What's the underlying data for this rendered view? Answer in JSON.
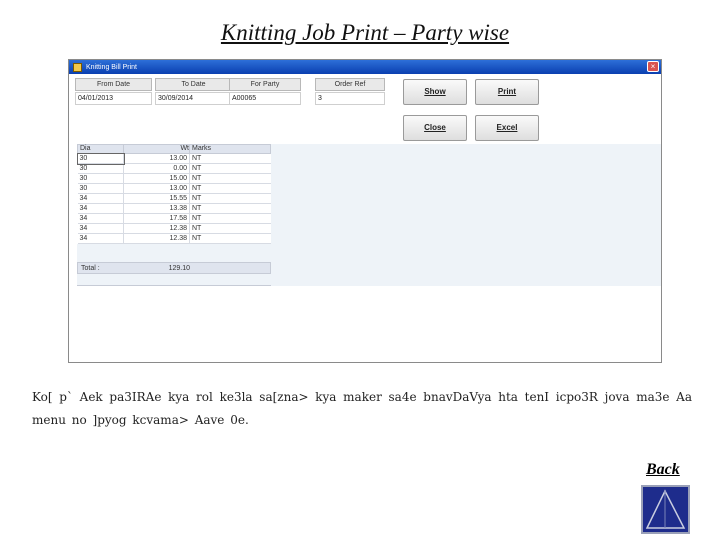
{
  "slide": {
    "title": "Knitting Job Print – Party wise",
    "description": "Ko[ p` Aek pa3IRAe kya rol ke3la sa[zna> kya maker sa4e bnavDaVya hta tenI icpo3R jova ma3e Aa menu  no ]pyog kcvama> Aave 0e.",
    "back_label": "Back"
  },
  "window": {
    "title": "Knitting Bill Print",
    "close_glyph": "×"
  },
  "filters": {
    "from_date": {
      "label": "From Date",
      "value": "04/01/2013"
    },
    "to_date": {
      "label": "To Date",
      "value": "30/09/2014"
    },
    "for_party": {
      "label": "For Party",
      "value": "A00065"
    },
    "order_ref": {
      "label": "Order Ref",
      "value": "3"
    }
  },
  "buttons": {
    "show": "Show",
    "print": "Print",
    "close": "Close",
    "excel": "Excel"
  },
  "table": {
    "headers": [
      "Dia",
      "Wt",
      "Marks"
    ],
    "rows": [
      {
        "dia": "30",
        "wt": "13.00",
        "marks": "NT"
      },
      {
        "dia": "30",
        "wt": "0.00",
        "marks": "NT"
      },
      {
        "dia": "30",
        "wt": "15.00",
        "marks": "NT"
      },
      {
        "dia": "30",
        "wt": "13.00",
        "marks": "NT"
      },
      {
        "dia": "34",
        "wt": "15.55",
        "marks": "NT"
      },
      {
        "dia": "34",
        "wt": "13.38",
        "marks": "NT"
      },
      {
        "dia": "34",
        "wt": "17.58",
        "marks": "NT"
      },
      {
        "dia": "34",
        "wt": "12.38",
        "marks": "NT"
      },
      {
        "dia": "34",
        "wt": "12.38",
        "marks": "NT"
      }
    ],
    "total_label": "Total :",
    "total_value": "129.10"
  }
}
